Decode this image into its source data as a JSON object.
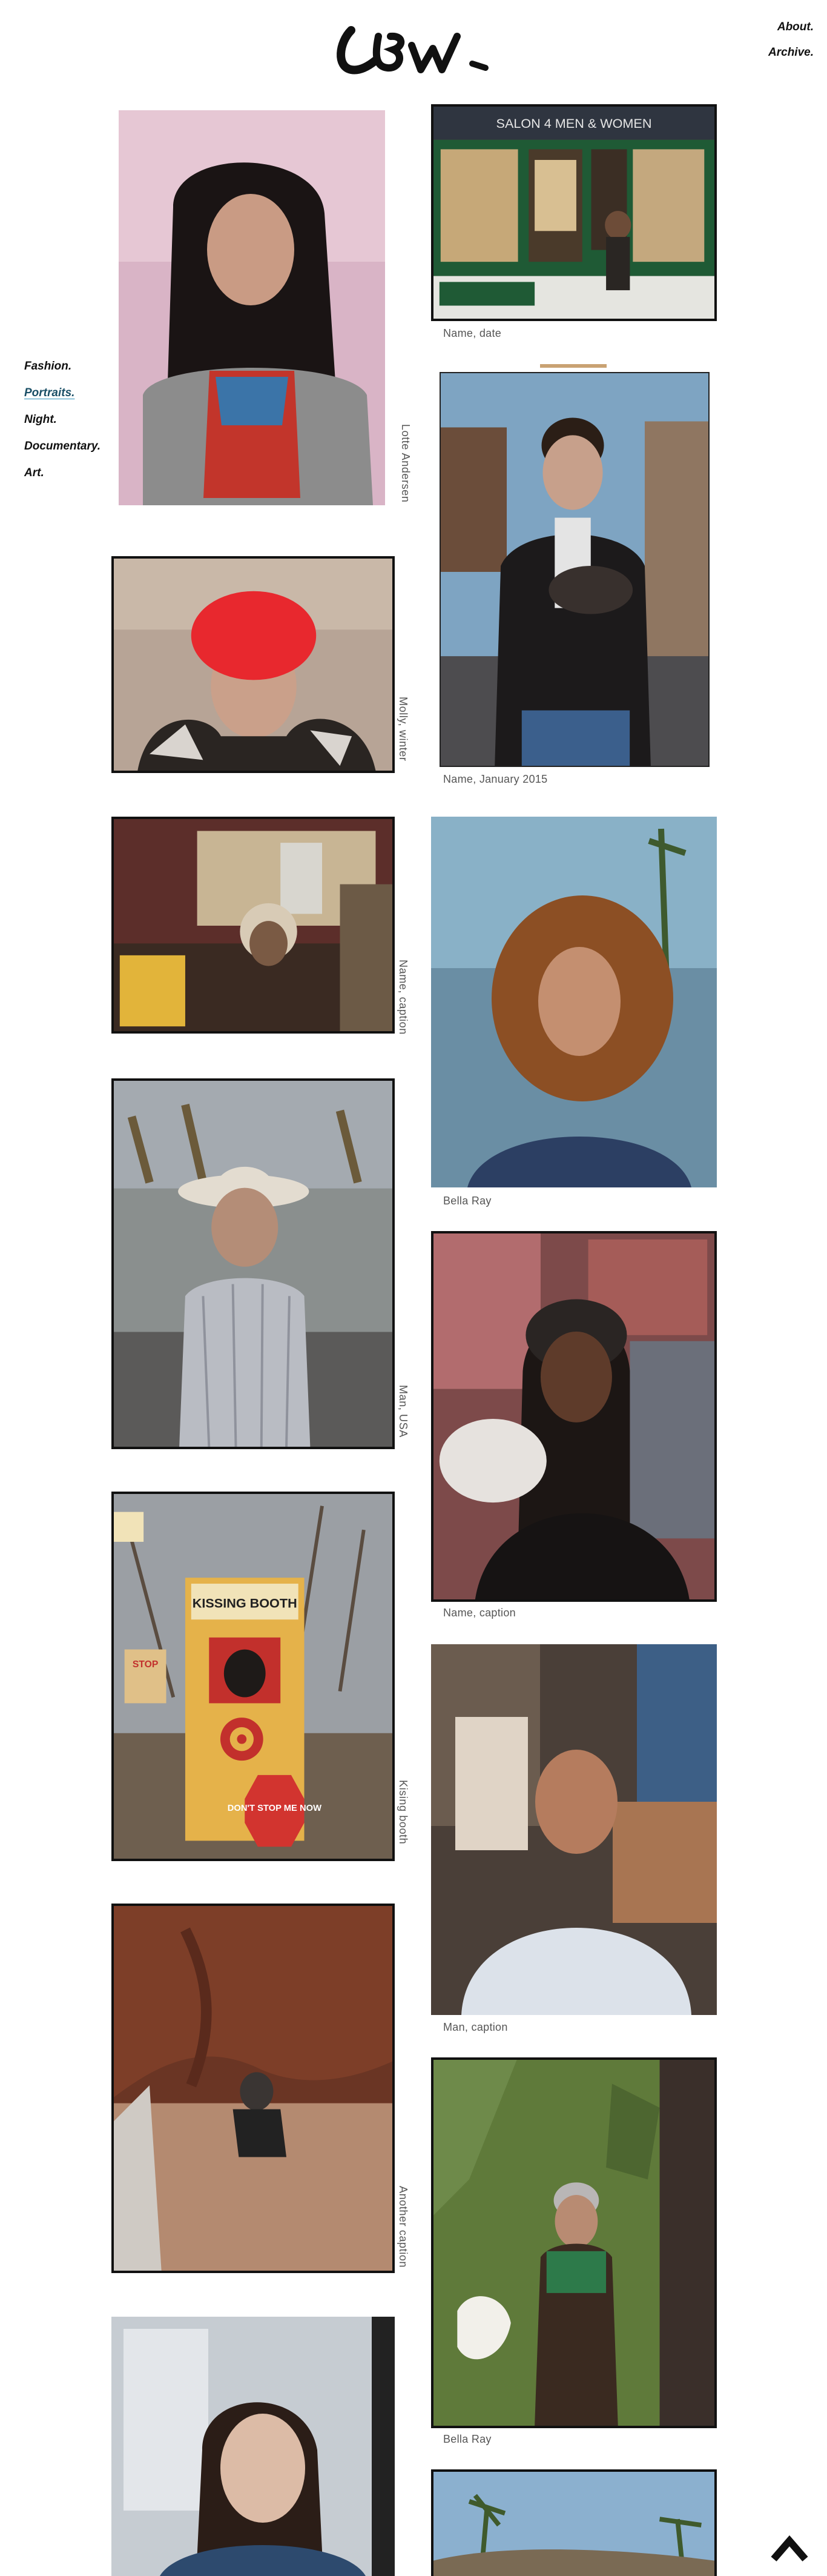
{
  "site": {
    "logo_text": "LBW.",
    "accent_color": "#2a8fb8"
  },
  "top_nav": [
    {
      "label": "About."
    },
    {
      "label": "Archive."
    }
  ],
  "side_nav": [
    {
      "label": "Fashion."
    },
    {
      "label": "Portraits.",
      "active": true
    },
    {
      "label": "Night."
    },
    {
      "label": "Documentary."
    },
    {
      "label": "Art."
    }
  ],
  "gallery": {
    "storefront_sign": "SALON 4 MEN & WOMEN",
    "booth_sign": "KISSING BOOTH",
    "stop_sign": "DON'T STOP ME NOW",
    "small_sign": "STOP",
    "photos": [
      {
        "caption": "Lotte Andersen"
      },
      {
        "caption": "Name, date"
      },
      {
        "caption": "Name, January 2015"
      },
      {
        "caption": "Molly, winter"
      },
      {
        "caption": "Name, caption"
      },
      {
        "caption": "Bella Ray"
      },
      {
        "caption": "Man, USA"
      },
      {
        "caption": "Name, caption"
      },
      {
        "caption": "Kising booth"
      },
      {
        "caption": "Man, caption"
      },
      {
        "caption": "Another caption"
      },
      {
        "caption": "Bella Ray"
      }
    ]
  },
  "icons": {
    "back_to_top": "chevron-up-icon"
  }
}
